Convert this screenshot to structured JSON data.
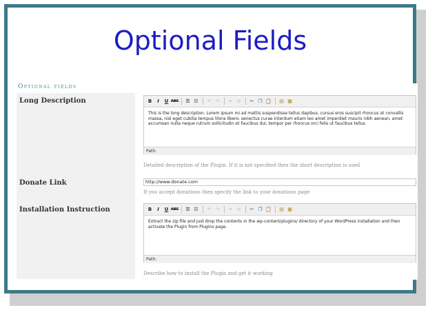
{
  "slide": {
    "title": "Optional Fields"
  },
  "section": {
    "title": "Optional fields"
  },
  "toolbar_buttons": [
    {
      "name": "bold-icon",
      "label": "B"
    },
    {
      "name": "italic-icon",
      "label": "I"
    },
    {
      "name": "underline-icon",
      "label": "U"
    },
    {
      "name": "strikethrough-icon",
      "label": "ABC"
    },
    {
      "name": "bullet-list-icon",
      "label": "☰"
    },
    {
      "name": "numbered-list-icon",
      "label": "☷"
    },
    {
      "name": "undo-icon",
      "label": "↶"
    },
    {
      "name": "redo-icon",
      "label": "↷"
    },
    {
      "name": "link-icon",
      "label": "⚭"
    },
    {
      "name": "unlink-icon",
      "label": "⊘"
    },
    {
      "name": "cut-icon",
      "label": "✂"
    },
    {
      "name": "copy-icon",
      "label": "❐"
    },
    {
      "name": "paste-icon",
      "label": "📋"
    },
    {
      "name": "paste-text-icon",
      "label": "▤"
    },
    {
      "name": "paste-word-icon",
      "label": "▦"
    }
  ],
  "fields": {
    "long_description": {
      "label": "Long Description",
      "content": "This is the long description. Lorem ipsum mi ad mattis suspendisse tellus dapibus, cursus eros suscipit rhoncus at convallis massa, nisl eget cubilia tempus litora libero. senectus curae interdum etiam leo amet imperdiet mauris nibh aenean, amet accumsan nulla neque rutrum sollicitudin et faucibus dui, tempor per rhoncus orci felis ut faucibus tellus.",
      "path_label": "Path:",
      "help": "Detailed description of the Plugin. If it is not specified then the short description is used"
    },
    "donate_link": {
      "label": "Donate Link",
      "value": "http://www.donate.com",
      "help": "If you accept donations then specify the link to your donations page"
    },
    "installation": {
      "label": "Installation Instruction",
      "content": "Extract the zip file and just drop the contents in the wp-content/plugins/ directory of your WordPress installation and then activate the Plugin from Plugins page.",
      "path_label": "Path:",
      "help": "Describe how to install the Plugin and get it working"
    }
  }
}
